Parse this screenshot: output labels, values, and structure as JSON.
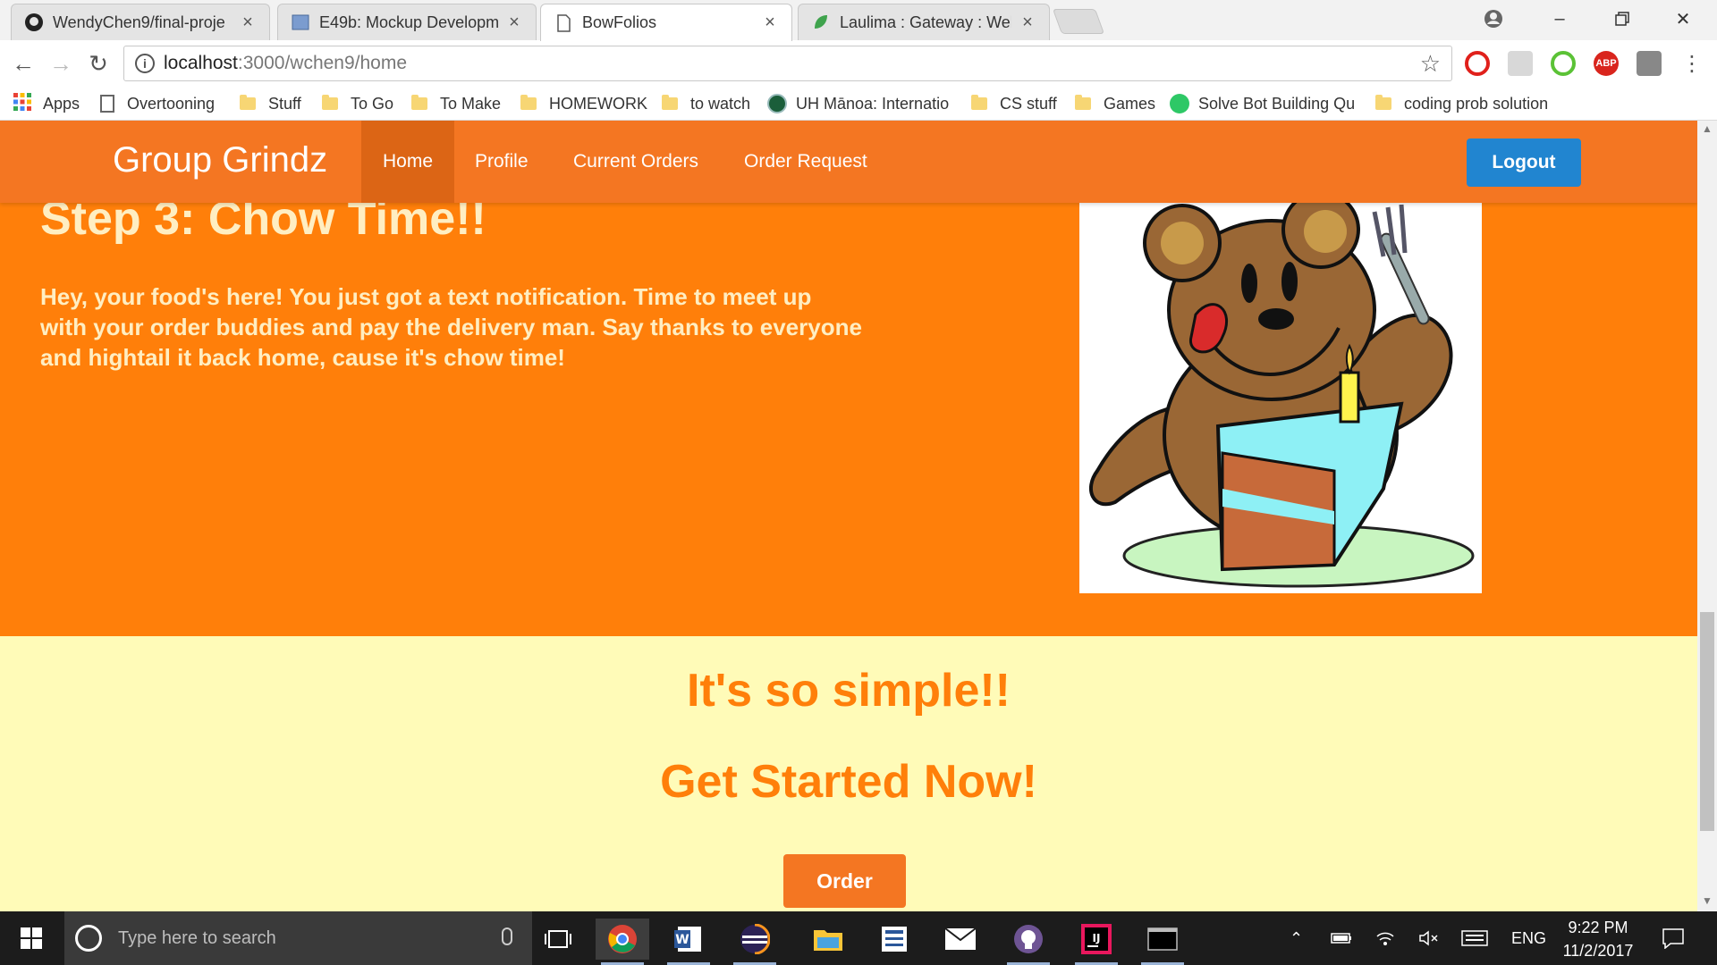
{
  "browser": {
    "tabs": [
      {
        "title": "WendyChen9/final-proje",
        "icon": "github-icon",
        "active": false
      },
      {
        "title": "E49b: Mockup Developm",
        "icon": "page-icon",
        "active": false
      },
      {
        "title": "BowFolios",
        "icon": "document-icon",
        "active": true
      },
      {
        "title": "Laulima : Gateway : Welc",
        "icon": "laulima-icon",
        "active": false
      }
    ],
    "url_host": "localhost",
    "url_path": ":3000/wchen9/home",
    "bookmarks": [
      {
        "label": "Apps",
        "icon": "apps-grid-icon"
      },
      {
        "label": "Overtooning",
        "icon": "page-icon"
      },
      {
        "label": "Stuff",
        "icon": "folder-icon"
      },
      {
        "label": "To Go",
        "icon": "folder-icon"
      },
      {
        "label": "To Make",
        "icon": "folder-icon"
      },
      {
        "label": "HOMEWORK",
        "icon": "folder-icon"
      },
      {
        "label": "to watch",
        "icon": "folder-icon"
      },
      {
        "label": "UH Mānoa: Internatio",
        "icon": "uh-seal-icon"
      },
      {
        "label": "CS stuff",
        "icon": "folder-icon"
      },
      {
        "label": "Games",
        "icon": "folder-icon"
      },
      {
        "label": "Solve Bot Building Qu",
        "icon": "hackerrank-icon"
      },
      {
        "label": "coding prob solution",
        "icon": "folder-icon"
      }
    ],
    "extensions": [
      "opera-icon",
      "puzzle-icon",
      "qr-icon",
      "abp-icon",
      "sync-icon"
    ],
    "ext_abp_label": "ABP"
  },
  "site": {
    "brand": "Group Grindz",
    "nav": [
      {
        "label": "Home",
        "active": true
      },
      {
        "label": "Profile",
        "active": false
      },
      {
        "label": "Current Orders",
        "active": false
      },
      {
        "label": "Order Request",
        "active": false
      }
    ],
    "logout_label": "Logout",
    "step_title": "Step 3: Chow Time!!",
    "step_body": "Hey, your food's here! You just got a text notification. Time to meet up with your order buddies and pay the delivery man. Say thanks to everyone and hightail it back home, cause it's chow time!",
    "simple_heading": "It's so simple!!",
    "started_heading": "Get Started Now!",
    "order_label": "Order",
    "colors": {
      "hero": "#ff7f0a",
      "navbar": "#f47622",
      "cream": "#fffbb8",
      "logout": "#2185d0"
    }
  },
  "taskbar": {
    "search_placeholder": "Type here to search",
    "language": "ENG",
    "time": "9:22 PM",
    "date": "11/2/2017"
  }
}
